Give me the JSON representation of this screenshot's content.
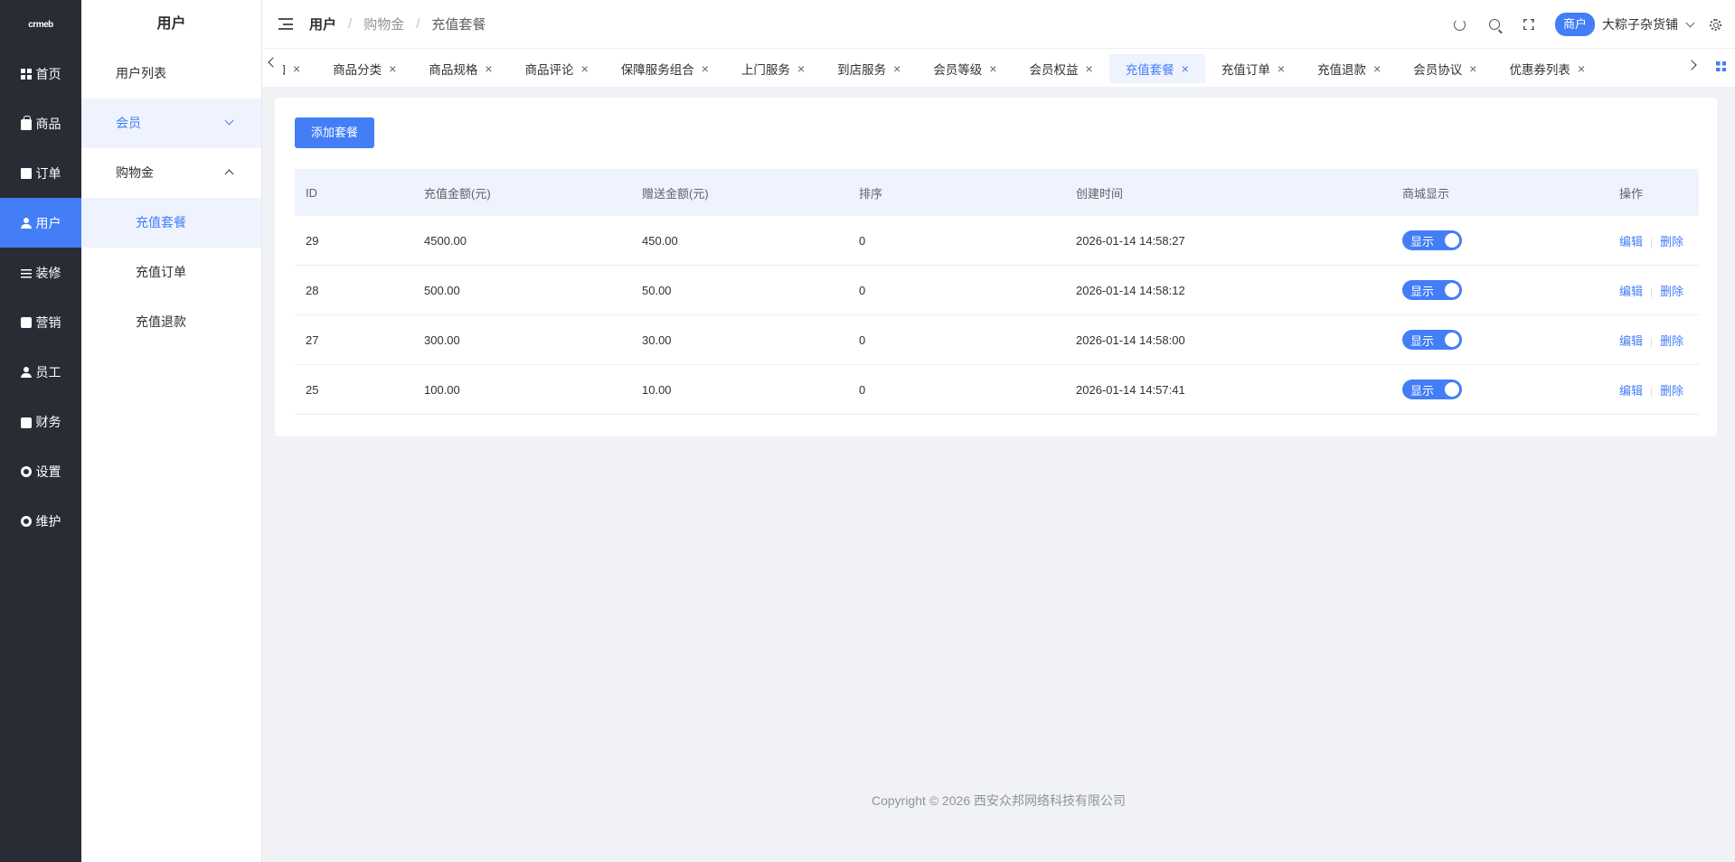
{
  "rail": {
    "logo": "crmeb",
    "items": [
      {
        "label": "首页",
        "icon": "grid-icon"
      },
      {
        "label": "商品",
        "icon": "bag-icon"
      },
      {
        "label": "订单",
        "icon": "document-icon"
      },
      {
        "label": "用户",
        "icon": "user-icon",
        "active": true
      },
      {
        "label": "装修",
        "icon": "sliders-icon"
      },
      {
        "label": "营销",
        "icon": "card-icon"
      },
      {
        "label": "员工",
        "icon": "staff-icon"
      },
      {
        "label": "财务",
        "icon": "wallet-icon"
      },
      {
        "label": "设置",
        "icon": "gear-icon"
      },
      {
        "label": "维护",
        "icon": "maintenance-icon"
      }
    ]
  },
  "submenu": {
    "title": "用户",
    "items": [
      {
        "label": "用户列表"
      },
      {
        "label": "会员"
      },
      {
        "label": "购物金"
      },
      {
        "label": "充值套餐"
      },
      {
        "label": "充值订单"
      },
      {
        "label": "充值退款"
      }
    ]
  },
  "header": {
    "breadcrumb": [
      "用户",
      "购物金",
      "充值套餐"
    ],
    "merchant_badge": "商户",
    "store_name": "大粽子杂货铺"
  },
  "tabs": {
    "items": [
      "添加",
      "商品分类",
      "商品规格",
      "商品评论",
      "保障服务组合",
      "上门服务",
      "到店服务",
      "会员等级",
      "会员权益",
      "充值套餐",
      "充值订单",
      "充值退款",
      "会员协议",
      "优惠券列表"
    ],
    "active_index": 9,
    "first_label_visible": "ぬ加"
  },
  "page": {
    "add_button": "添加套餐",
    "columns": [
      "ID",
      "充值金额(元)",
      "赠送金额(元)",
      "排序",
      "创建时间",
      "商城显示",
      "操作"
    ],
    "rows": [
      {
        "id": "29",
        "amount": "4500.00",
        "gift": "450.00",
        "sort": "0",
        "created": "2026-01-14 14:58:27",
        "show": "显示"
      },
      {
        "id": "28",
        "amount": "500.00",
        "gift": "50.00",
        "sort": "0",
        "created": "2026-01-14 14:58:12",
        "show": "显示"
      },
      {
        "id": "27",
        "amount": "300.00",
        "gift": "30.00",
        "sort": "0",
        "created": "2026-01-14 14:58:00",
        "show": "显示"
      },
      {
        "id": "25",
        "amount": "100.00",
        "gift": "10.00",
        "sort": "0",
        "created": "2026-01-14 14:57:41",
        "show": "显示"
      }
    ],
    "edit_label": "编辑",
    "delete_label": "删除"
  },
  "footer": {
    "copyright": "Copyright © 2026 西安众邦网络科技有限公司"
  },
  "colors": {
    "primary": "#437ef7",
    "rail_bg": "#282c34",
    "page_bg": "#f0f2f5"
  }
}
